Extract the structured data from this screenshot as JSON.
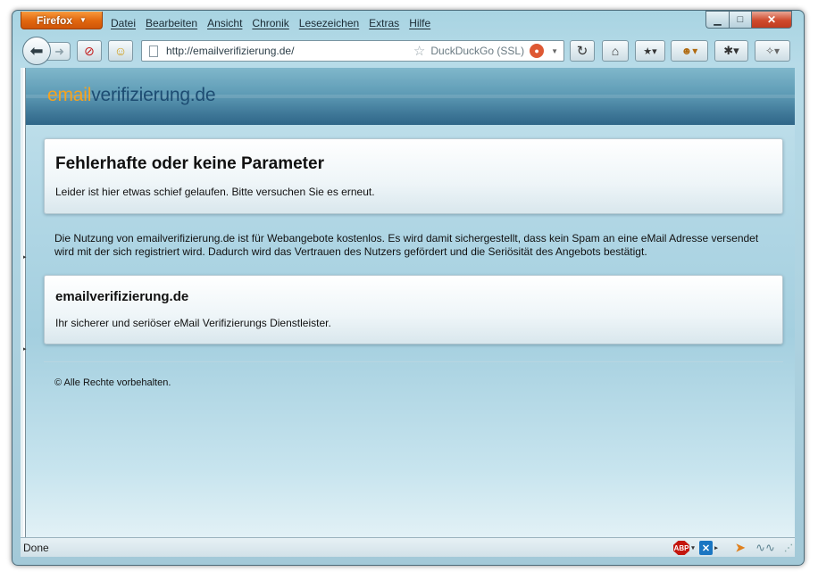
{
  "browser": {
    "button_label": "Firefox",
    "menu": [
      "Datei",
      "Bearbeiten",
      "Ansicht",
      "Chronik",
      "Lesezeichen",
      "Extras",
      "Hilfe"
    ],
    "url": "http://emailverifizierung.de/",
    "search_engine": "DuckDuckGo (SSL)",
    "status": "Done",
    "statusbar_icons": [
      "abp-icon",
      "x-icon",
      "fish-icon",
      "signature-icon"
    ]
  },
  "page": {
    "logo_part1": "email",
    "logo_part2": "verifizierung.de",
    "error_title": "Fehlerhafte oder keine Parameter",
    "error_text": "Leider ist hier etwas schief gelaufen. Bitte versuchen Sie es erneut.",
    "intro": "Die Nutzung von emailverifizierung.de ist für Webangebote kostenlos. Es wird damit sichergestellt, dass kein Spam an eine eMail Adresse versendet wird mit der sich registriert wird. Dadurch wird das Vertrauen des Nutzers gefördert und die Seriösität des Angebots bestätigt.",
    "info_title": "emailverifizierung.de",
    "info_text": "Ihr sicherer und seriöser eMail Verifizierungs Dienstleister.",
    "copyright": "© Alle Rechte vorbehalten."
  },
  "colors": {
    "logo_accent": "#f5a31f",
    "logo_main": "#1d4c72",
    "firefox_orange": "#e1660e"
  }
}
